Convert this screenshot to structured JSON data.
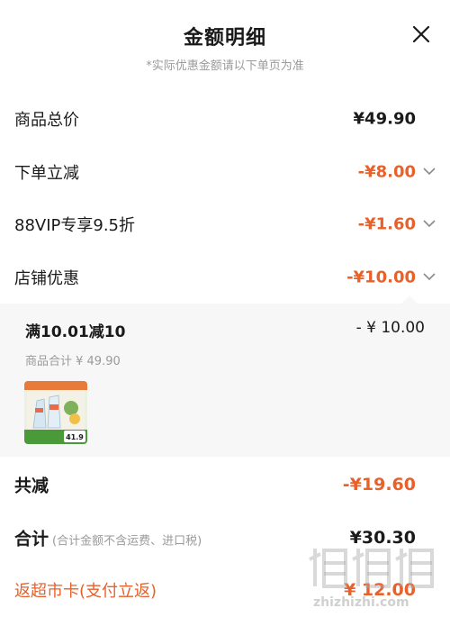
{
  "header": {
    "title": "金额明细",
    "subtitle": "*实际优惠金额请以下单页为准"
  },
  "rows": {
    "goods_total": {
      "label": "商品总价",
      "value": "¥49.90"
    },
    "order_discount": {
      "label": "下单立减",
      "value": "-¥8.00"
    },
    "vip_discount": {
      "label": "88VIP专享9.5折",
      "value": "-¥1.60"
    },
    "shop_discount": {
      "label": "店铺优惠",
      "value": "-¥10.00"
    }
  },
  "promo": {
    "title": "满10.01减10",
    "amount": "- ¥ 10.00",
    "subtotal": "商品合计 ¥ 49.90",
    "thumb_price": "41.9"
  },
  "summary": {
    "reduce_label": "共减",
    "reduce_value": "-¥19.60",
    "sum_label": "合计",
    "sum_note": "(合计金额不含运费、进口税)",
    "sum_value": "¥30.30",
    "card_label": "返超市卡(支付立返)",
    "card_value": "¥ 12.00"
  },
  "watermark": {
    "url": "zhizhizhi.com"
  },
  "colors": {
    "accent": "#e8602a",
    "muted": "#9a9a9a",
    "panel_bg": "#f7f7f7"
  },
  "icons": {
    "close": "close-icon",
    "chevron": "chevron-down-icon"
  }
}
